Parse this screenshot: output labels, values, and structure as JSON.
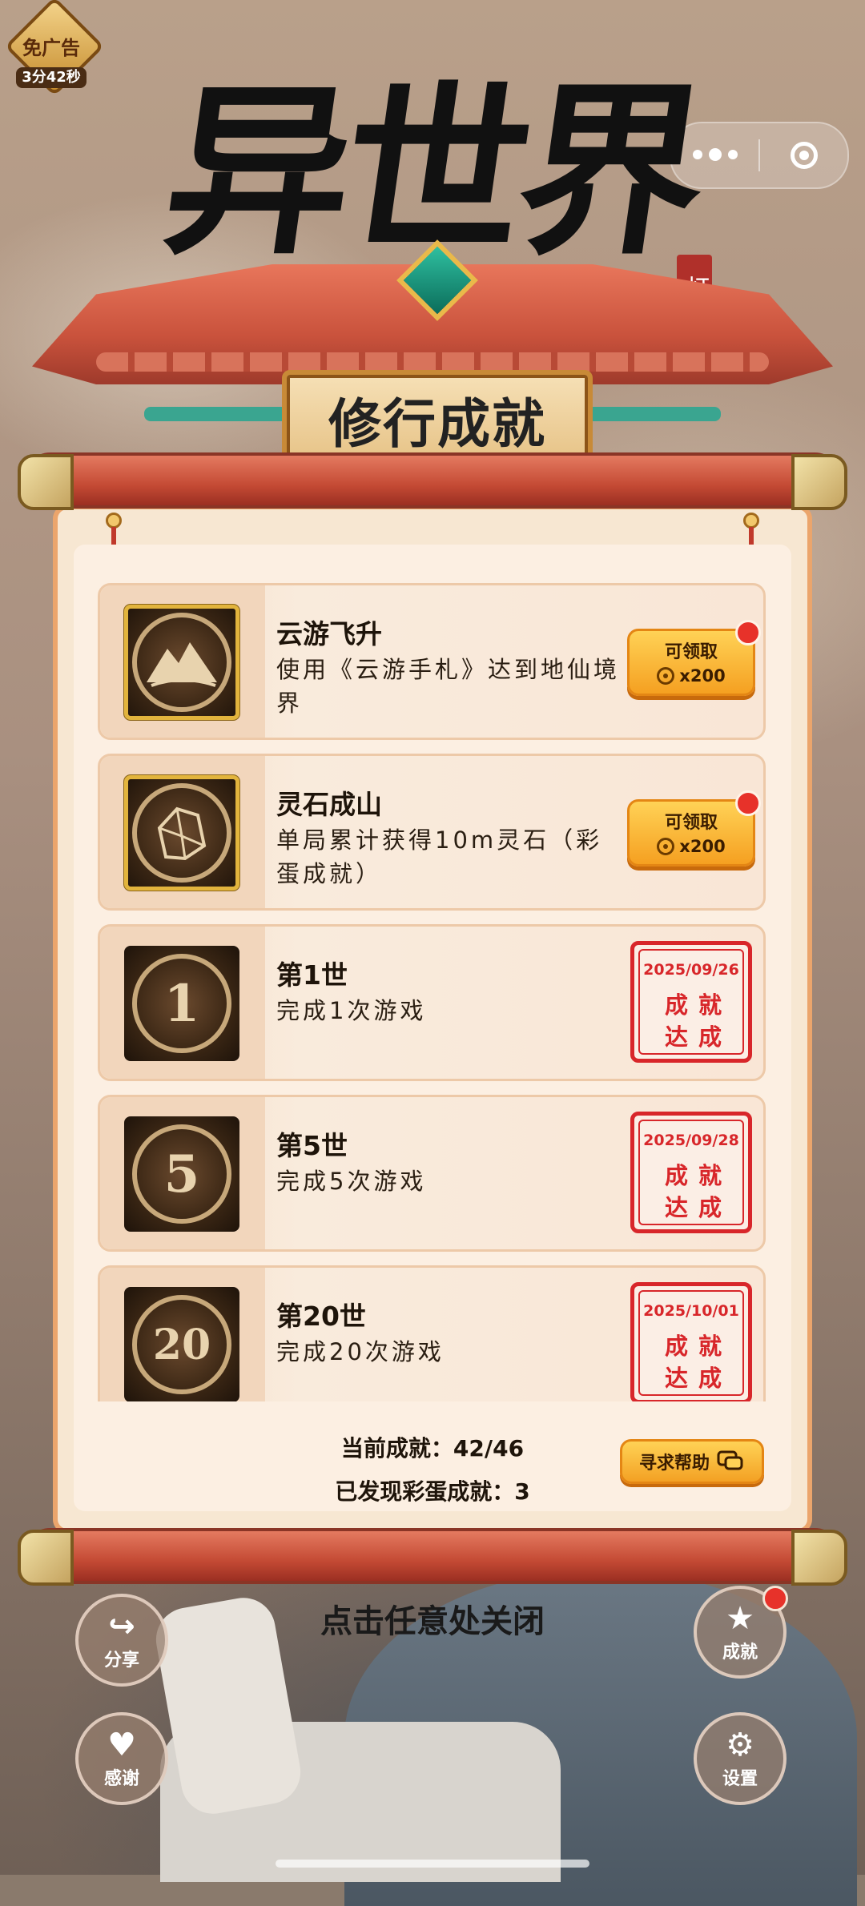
{
  "ad_badge": {
    "label": "免广告",
    "timer": "3分42秒"
  },
  "capsule": {
    "more_icon": "more-dots-icon",
    "close_icon": "target-close-icon"
  },
  "game_title": "异世界",
  "title_seal": "灯",
  "plaque_title": "修行成就",
  "achievements": [
    {
      "title": "云游飞升",
      "desc": "使用《云游手札》达到地仙境界",
      "icon": "mountain-cloud-icon",
      "status": "claimable",
      "claim_label": "可领取",
      "reward": "x200",
      "new": true
    },
    {
      "title": "灵石成山",
      "desc": "单局累计获得10m灵石（彩蛋成就）",
      "icon": "crystal-stone-icon",
      "status": "claimable",
      "claim_label": "可领取",
      "reward": "x200",
      "new": true
    },
    {
      "title": "第1世",
      "desc": "完成1次游戏",
      "icon_text": "1",
      "status": "done",
      "date": "2025/09/26",
      "stamp": [
        "成",
        "就",
        "达",
        "成"
      ]
    },
    {
      "title": "第5世",
      "desc": "完成5次游戏",
      "icon_text": "5",
      "status": "done",
      "date": "2025/09/28",
      "stamp": [
        "成",
        "就",
        "达",
        "成"
      ]
    },
    {
      "title": "第20世",
      "desc": "完成20次游戏",
      "icon_text": "20",
      "status": "done",
      "date": "2025/10/01",
      "stamp": [
        "成",
        "就",
        "达",
        "成"
      ]
    }
  ],
  "stats": {
    "current": "当前成就：42/46",
    "eggs": "已发现彩蛋成就：3"
  },
  "help_button": "寻求帮助",
  "close_hint": "点击任意处关闭",
  "side_buttons": {
    "share": "分享",
    "achievements": "成就",
    "thanks": "感谢",
    "settings": "设置"
  },
  "colors": {
    "accent": "#f5a021",
    "stamp_red": "#d8262a",
    "roof_red": "#c9523c",
    "jade": "#3aa590"
  }
}
